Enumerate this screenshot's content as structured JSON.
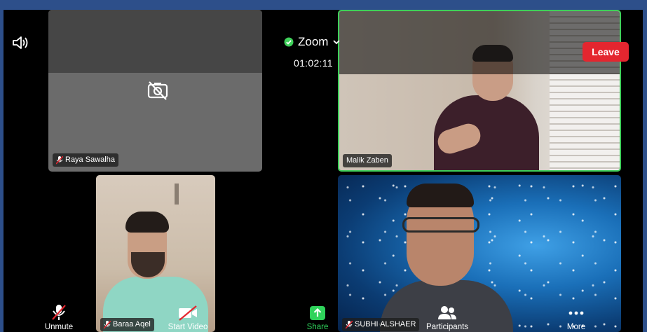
{
  "app": {
    "title": "Zoom",
    "timer": "01:02:11"
  },
  "buttons": {
    "leave": "Leave"
  },
  "participants": [
    {
      "name": "Raya Sawalha"
    },
    {
      "name": "Malik Zaben"
    },
    {
      "name": "Baraa Aqel"
    },
    {
      "name": "SUBHI ALSHAER"
    }
  ],
  "toolbar": {
    "unmute": "Unmute",
    "start_video": "Start Video",
    "share": "Share",
    "participants": "Participants",
    "more": "More"
  },
  "colors": {
    "leave": "#e4262f",
    "active_speaker": "#3fd05a",
    "share": "#2fd35b",
    "shield": "#3fd05a"
  },
  "icons": [
    "speaker-icon",
    "shield-check-icon",
    "chevron-down-icon",
    "video-off-icon",
    "mic-muted-icon",
    "video-muted-icon",
    "share-icon",
    "participants-icon",
    "more-icon"
  ]
}
